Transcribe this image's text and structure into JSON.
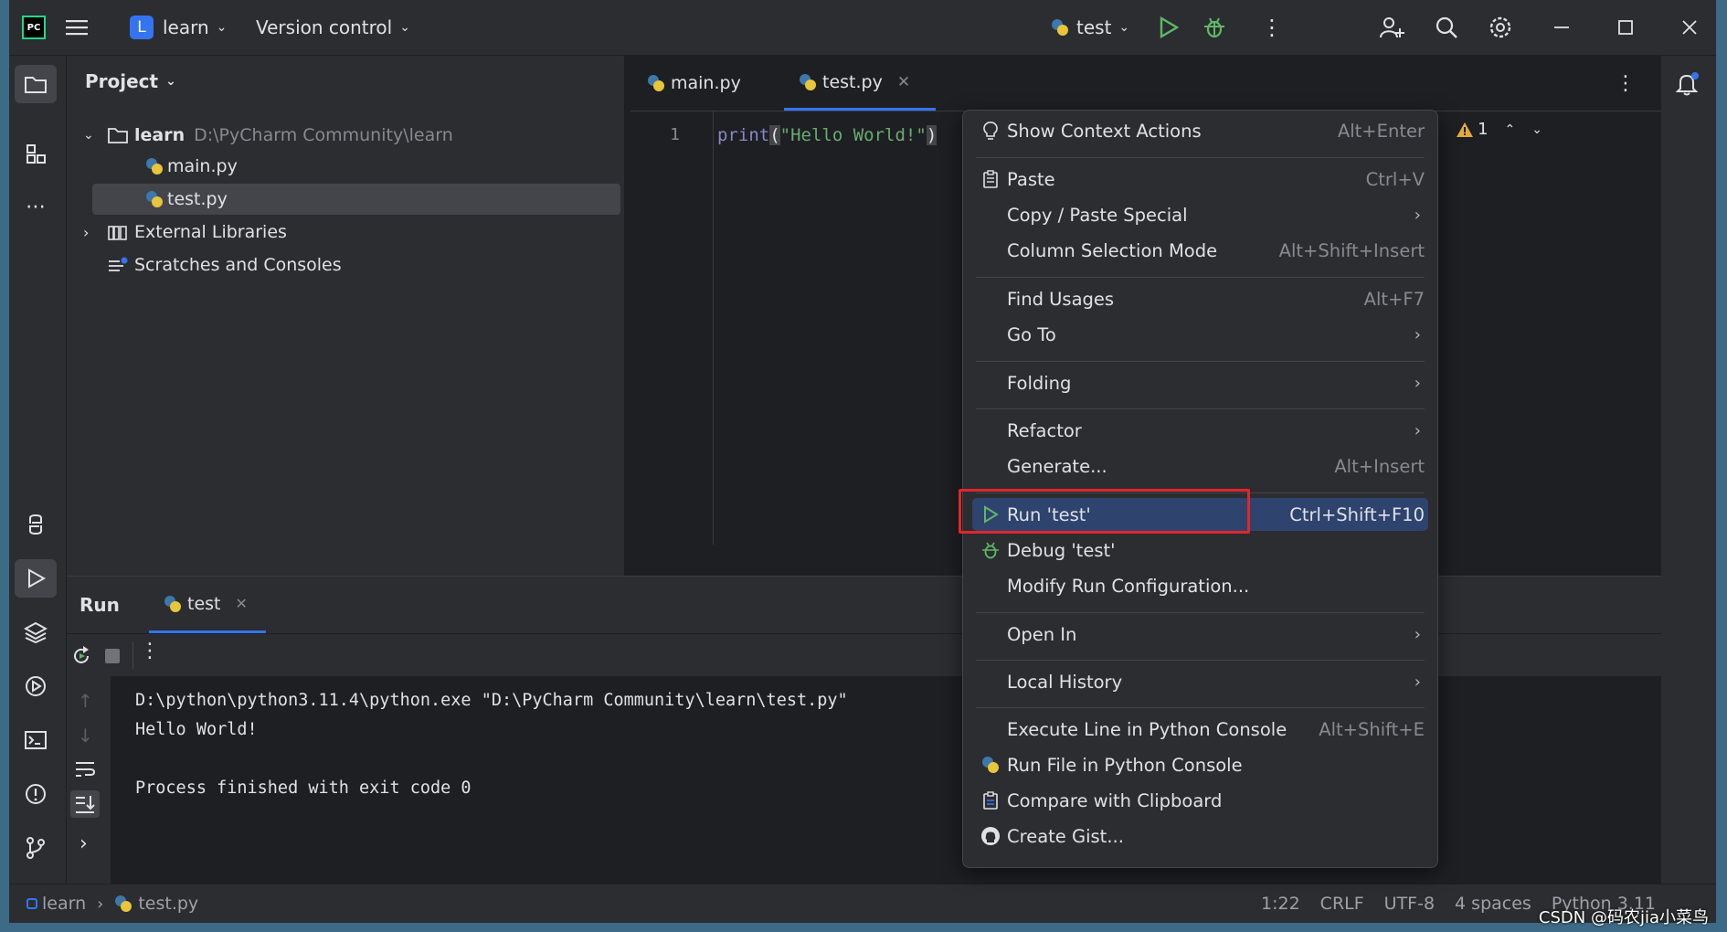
{
  "titlebar": {
    "logo": "PC",
    "project_badge": "L",
    "project_name": "learn",
    "vcs_menu": "Version control",
    "run_config": "test"
  },
  "project_panel": {
    "title": "Project",
    "root_name": "learn",
    "root_path": "D:\\PyCharm Community\\learn",
    "files": [
      "main.py",
      "test.py"
    ],
    "external": "External Libraries",
    "scratches": "Scratches and Consoles"
  },
  "editor": {
    "tabs": [
      {
        "label": "main.py"
      },
      {
        "label": "test.py"
      }
    ],
    "line_number": "1",
    "code_fn": "print",
    "code_paren_open": "(",
    "code_string": "\"Hello World!\"",
    "code_paren_close": ")",
    "warning_count": "1"
  },
  "run_panel": {
    "title": "Run",
    "tab": "test",
    "output_cmd": "D:\\python\\python3.11.4\\python.exe \"D:\\PyCharm Community\\learn\\test.py\"",
    "output_line": "Hello World!",
    "output_exit": "Process finished with exit code 0"
  },
  "context_menu": {
    "show_context_actions": {
      "label": "Show Context Actions",
      "shortcut": "Alt+Enter"
    },
    "paste": {
      "label": "Paste",
      "shortcut": "Ctrl+V"
    },
    "copy_paste_special": {
      "label": "Copy / Paste Special"
    },
    "column_selection": {
      "label": "Column Selection Mode",
      "shortcut": "Alt+Shift+Insert"
    },
    "find_usages": {
      "label": "Find Usages",
      "shortcut": "Alt+F7"
    },
    "go_to": {
      "label": "Go To"
    },
    "folding": {
      "label": "Folding"
    },
    "refactor": {
      "label": "Refactor"
    },
    "generate": {
      "label": "Generate...",
      "shortcut": "Alt+Insert"
    },
    "run_test": {
      "label": "Run 'test'",
      "shortcut": "Ctrl+Shift+F10"
    },
    "debug_test": {
      "label": "Debug 'test'"
    },
    "modify_run": {
      "label": "Modify Run Configuration..."
    },
    "open_in": {
      "label": "Open In"
    },
    "local_history": {
      "label": "Local History"
    },
    "execute_line": {
      "label": "Execute Line in Python Console",
      "shortcut": "Alt+Shift+E"
    },
    "run_file_console": {
      "label": "Run File in Python Console"
    },
    "compare_clipboard": {
      "label": "Compare with Clipboard"
    },
    "create_gist": {
      "label": "Create Gist..."
    }
  },
  "statusbar": {
    "crumb_project": "learn",
    "crumb_file": "test.py",
    "position": "1:22",
    "line_sep": "CRLF",
    "encoding": "UTF-8",
    "indent": "4 spaces",
    "interpreter": "Python 3.11"
  },
  "watermark": "CSDN @码农jia小菜鸟",
  "colors": {
    "accent": "#3574f0",
    "highlight": "#2e436e",
    "run_green": "#5fb865",
    "annotation_red": "#e0262b",
    "warning": "#e5a93d"
  }
}
